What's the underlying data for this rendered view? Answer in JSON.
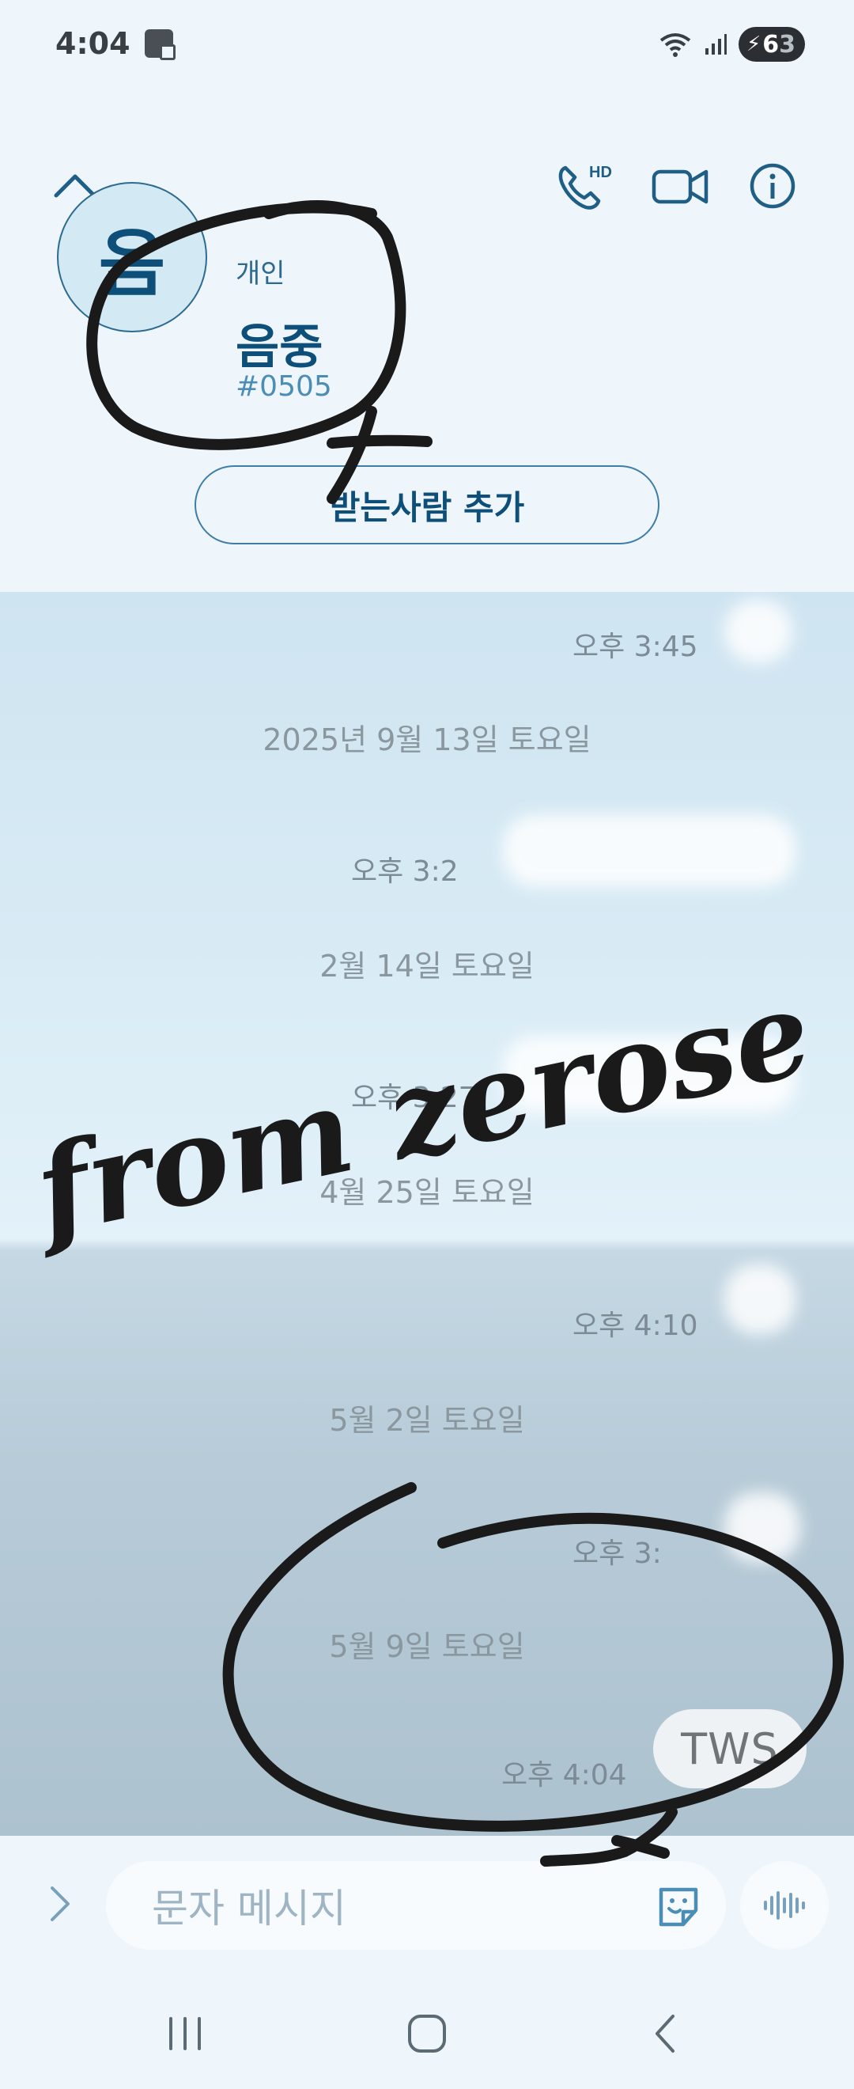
{
  "status_bar": {
    "time": "4:04",
    "wifi_label": "5",
    "battery_a": "6",
    "battery_b": "3"
  },
  "contact": {
    "type": "개인",
    "name": "음중",
    "id": "#0505",
    "avatar_letter": "음"
  },
  "header": {
    "add_recipient_label": "받는사람 추가",
    "call_badge": "HD"
  },
  "messages": [
    {
      "time": "오후 3:45"
    },
    {
      "date": "2025년 9월 13일 토요일"
    },
    {
      "time": "오후 3:2"
    },
    {
      "date": "2월 14일 토요일"
    },
    {
      "time": "오후 3:27"
    },
    {
      "date": "4월 25일 토요일"
    },
    {
      "time": "오후 4:10"
    },
    {
      "date": "5월 2일 토요일"
    },
    {
      "time": "오후 3:"
    },
    {
      "date": "5월 9일 토요일"
    },
    {
      "time": "오후 4:04",
      "text": "TWS"
    }
  ],
  "input": {
    "placeholder": "문자 메시지"
  },
  "overlay": {
    "handwriting": "from zerose"
  },
  "colors": {
    "accent": "#1f5f86",
    "background": "#eef5fb"
  },
  "icons": [
    "collapse-up-icon",
    "hd-call-icon",
    "video-call-icon",
    "info-icon",
    "expand-icon",
    "sticker-icon",
    "voice-icon",
    "recent-apps-icon",
    "home-icon",
    "back-icon"
  ]
}
